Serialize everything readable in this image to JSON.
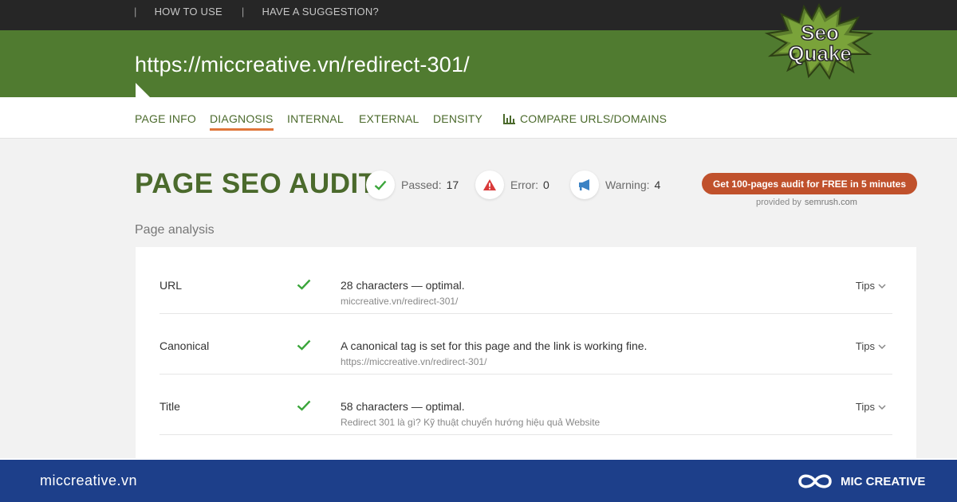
{
  "topbar": {
    "links": [
      "HOW TO USE",
      "HAVE A SUGGESTION?"
    ],
    "separator": "|"
  },
  "header": {
    "url": "https://miccreative.vn/redirect-301/",
    "logo_line1": "Seo",
    "logo_line2": "Quake"
  },
  "nav": {
    "tabs": [
      "PAGE INFO",
      "DIAGNOSIS",
      "INTERNAL",
      "EXTERNAL",
      "DENSITY"
    ],
    "compare_label": "COMPARE URLS/DOMAINS",
    "active_tab": "DIAGNOSIS"
  },
  "audit": {
    "title": "PAGE SEO AUDIT",
    "passed_label": "Passed:",
    "passed_value": "17",
    "error_label": "Error:",
    "error_value": "0",
    "warning_label": "Warning:",
    "warning_value": "4",
    "cta": "Get 100-pages audit for FREE in 5 minutes",
    "provided_by": "provided by",
    "provider": "semrush.com"
  },
  "section_title": "Page analysis",
  "rows": [
    {
      "name": "URL",
      "main": "28 characters — optimal.",
      "sub": "miccreative.vn/redirect-301/",
      "tips": "Tips"
    },
    {
      "name": "Canonical",
      "main": "A canonical tag is set for this page and the link is working fine.",
      "sub": "https://miccreative.vn/redirect-301/",
      "tips": "Tips"
    },
    {
      "name": "Title",
      "main": "58 characters — optimal.",
      "sub": "Redirect 301 là gì? Kỹ thuật chuyển hướng hiệu quả Website",
      "tips": "Tips"
    }
  ],
  "footer": {
    "site": "miccreative.vn",
    "brand": "MIC CREATIVE"
  },
  "colors": {
    "header_green": "#507b30",
    "title_green": "#4b6a2c",
    "cta_red": "#c0512c",
    "tab_underline": "#e0763a",
    "check_green": "#3aa53a",
    "footer_blue": "#1d3f8a"
  },
  "icons": {
    "passed": "check-icon",
    "error": "warning-triangle-icon",
    "warning": "megaphone-icon",
    "compare": "bar-chart-icon",
    "tips": "chevron-down-icon",
    "brand": "infinity-logo-icon"
  }
}
